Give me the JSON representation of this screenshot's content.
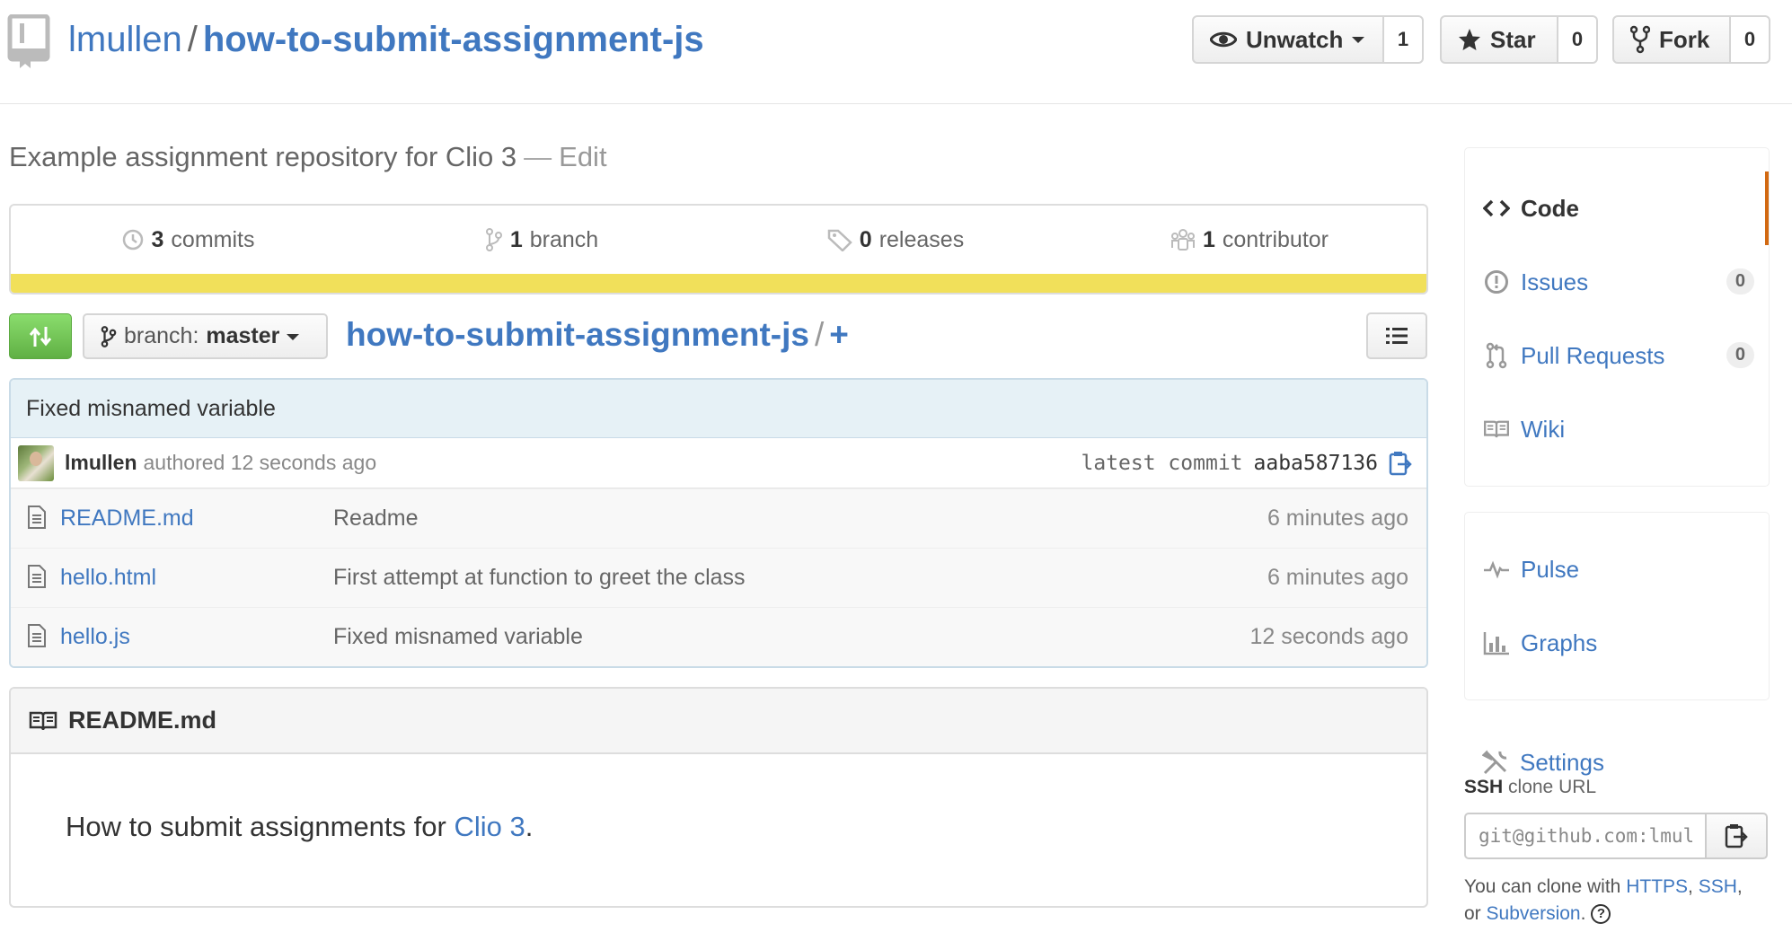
{
  "header": {
    "owner": "lmullen",
    "separator": "/",
    "repo_name": "how-to-submit-assignment-js",
    "watch": {
      "label": "Unwatch",
      "count": "1"
    },
    "star": {
      "label": "Star",
      "count": "0"
    },
    "fork": {
      "label": "Fork",
      "count": "0"
    }
  },
  "description": {
    "text": "Example assignment repository for Clio 3",
    "dash": "—",
    "edit_label": "Edit"
  },
  "summary": {
    "commits": {
      "count": "3",
      "label": "commits"
    },
    "branches": {
      "count": "1",
      "label": "branch"
    },
    "releases": {
      "count": "0",
      "label": "releases"
    },
    "contributors": {
      "count": "1",
      "label": "contributor"
    },
    "language_color": "#f1e05a"
  },
  "file_nav": {
    "branch_prefix": "branch:",
    "branch_name": "master",
    "breadcrumb_repo": "how-to-submit-assignment-js",
    "breadcrumb_sep": "/",
    "breadcrumb_plus": "+"
  },
  "commit": {
    "message": "Fixed misnamed variable",
    "author": "lmullen",
    "authored_text": "authored 12 seconds ago",
    "latest_label": "latest commit",
    "sha": "aaba587136"
  },
  "files": [
    {
      "name": "README.md",
      "message": "Readme",
      "age": "6 minutes ago"
    },
    {
      "name": "hello.html",
      "message": "First attempt at function to greet the class",
      "age": "6 minutes ago"
    },
    {
      "name": "hello.js",
      "message": "Fixed misnamed variable",
      "age": "12 seconds ago"
    }
  ],
  "readme": {
    "title": "README.md",
    "body_prefix": "How to submit assignments for ",
    "body_link": "Clio 3",
    "body_suffix": "."
  },
  "sidebar": {
    "code": "Code",
    "issues": {
      "label": "Issues",
      "count": "0"
    },
    "pulls": {
      "label": "Pull Requests",
      "count": "0"
    },
    "wiki": "Wiki",
    "pulse": "Pulse",
    "graphs": "Graphs",
    "settings": "Settings"
  },
  "clone": {
    "protocol": "SSH",
    "label": "clone URL",
    "url": "git@github.com:lmullen/how-to-submit-assignment-js.git",
    "help_prefix": "You can clone with",
    "https": "HTTPS",
    "comma": ",",
    "ssh": "SSH",
    "or": "or",
    "subversion": "Subversion",
    "period": "."
  },
  "colors": {
    "link": "#4078c0",
    "accent_orange": "#d26911",
    "compare_green": "#6cc644"
  }
}
